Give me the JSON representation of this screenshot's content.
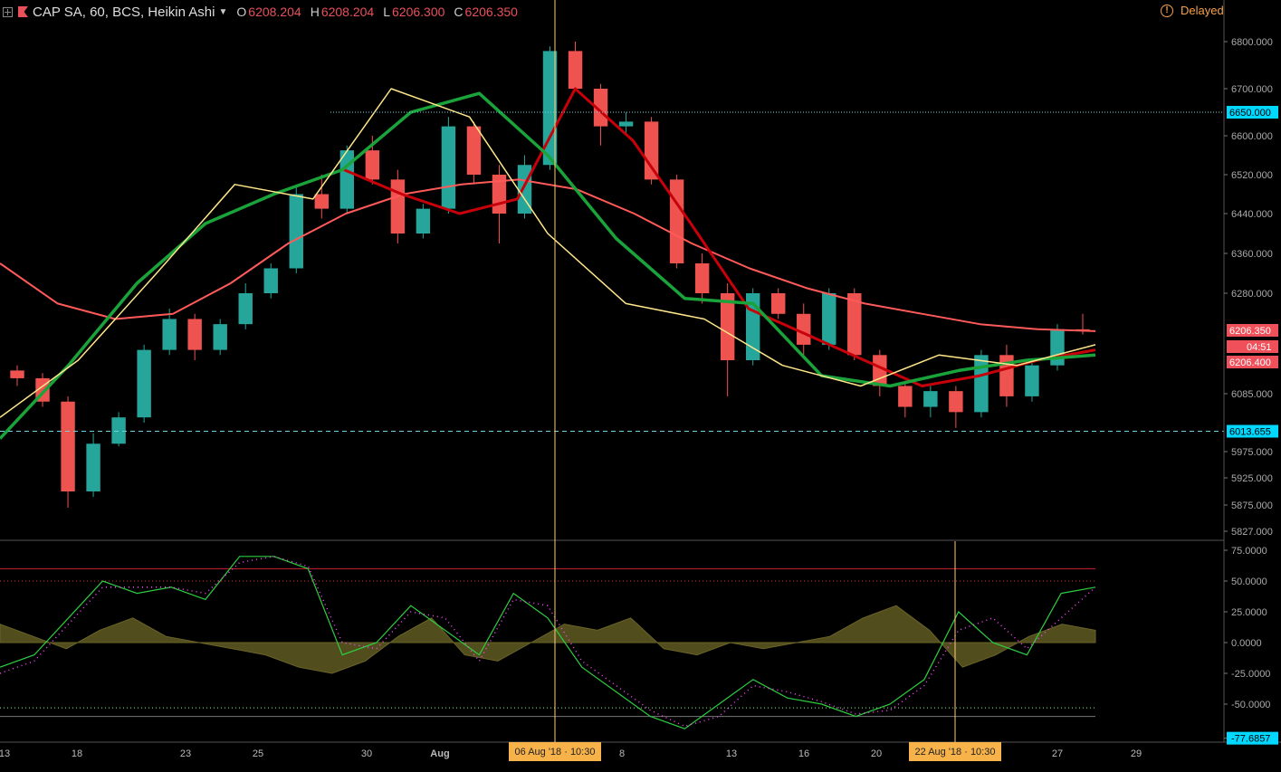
{
  "header": {
    "symbol": "CAP SA, 60, BCS, Heikin Ashi",
    "open_label": "O",
    "open_value": "6208.204",
    "high_label": "H",
    "high_value": "6208.204",
    "low_label": "L",
    "low_value": "6206.300",
    "close_label": "C",
    "close_value": "6206.350",
    "status": "Delayed"
  },
  "colors": {
    "up": "#26a69a",
    "down": "#ef5350",
    "accent_cyan": "#00d8ff",
    "ma_red": "#ff5a5a",
    "ma_dark_red": "#c8000a",
    "ma_green": "#1aa33a",
    "ma_yellow": "#ffe68a"
  },
  "icons": {
    "add": "plus-square-icon",
    "flag": "red-flag-icon",
    "status": "exclamation-circle-icon"
  },
  "chart_data": [
    {
      "type": "candlestick",
      "style": "Heikin Ashi",
      "price_axis_ticks": [
        "6800.000",
        "6700.000",
        "6600.000",
        "6520.000",
        "6440.000",
        "6360.000",
        "6280.000",
        "6085.000",
        "5975.000",
        "5925.000",
        "5875.000",
        "5827.000"
      ],
      "price_axis_tick_values": [
        6800,
        6700,
        6600,
        6520,
        6440,
        6360,
        6280,
        6085,
        5975,
        5925,
        5875,
        5827
      ],
      "time_axis_labels": [
        "13",
        "18",
        "23",
        "25",
        "30",
        "Aug",
        "6",
        "8",
        "13",
        "16",
        "20",
        "23",
        "27",
        "29"
      ],
      "markers": [
        {
          "label": "6650.000",
          "value": 6650,
          "color": "cyan"
        },
        {
          "label": "6206.350",
          "value": 6206.35,
          "color": "red"
        },
        {
          "label": "04:51",
          "color": "red"
        },
        {
          "label": "6206.400",
          "value": 6206.4,
          "color": "red"
        },
        {
          "label": "6013.655",
          "value": 6013.655,
          "color": "cyan"
        }
      ],
      "crosshair_labels": [
        "06 Aug '18 · 10:30",
        "22 Aug '18 · 10:30"
      ],
      "candles_ohlc_approx": [
        [
          6130,
          6140,
          6100,
          6115
        ],
        [
          6115,
          6125,
          6060,
          6070
        ],
        [
          6070,
          6080,
          5870,
          5900
        ],
        [
          5900,
          6010,
          5890,
          5990
        ],
        [
          5990,
          6050,
          5985,
          6040
        ],
        [
          6040,
          6180,
          6030,
          6170
        ],
        [
          6170,
          6250,
          6160,
          6230
        ],
        [
          6230,
          6240,
          6150,
          6170
        ],
        [
          6170,
          6230,
          6160,
          6220
        ],
        [
          6220,
          6300,
          6210,
          6280
        ],
        [
          6280,
          6340,
          6270,
          6330
        ],
        [
          6330,
          6500,
          6320,
          6480
        ],
        [
          6480,
          6520,
          6430,
          6450
        ],
        [
          6450,
          6580,
          6440,
          6570
        ],
        [
          6570,
          6600,
          6500,
          6510
        ],
        [
          6510,
          6530,
          6380,
          6400
        ],
        [
          6400,
          6460,
          6390,
          6450
        ],
        [
          6450,
          6640,
          6440,
          6620
        ],
        [
          6620,
          6630,
          6500,
          6520
        ],
        [
          6520,
          6540,
          6380,
          6440
        ],
        [
          6440,
          6560,
          6430,
          6540
        ],
        [
          6540,
          6790,
          6530,
          6780
        ],
        [
          6780,
          6800,
          6720,
          6700
        ],
        [
          6700,
          6710,
          6580,
          6620
        ],
        [
          6620,
          6650,
          6600,
          6630
        ],
        [
          6630,
          6640,
          6500,
          6510
        ],
        [
          6510,
          6520,
          6330,
          6340
        ],
        [
          6340,
          6360,
          6260,
          6280
        ],
        [
          6280,
          6300,
          6080,
          6150
        ],
        [
          6150,
          6290,
          6140,
          6280
        ],
        [
          6280,
          6290,
          6230,
          6240
        ],
        [
          6240,
          6260,
          6160,
          6180
        ],
        [
          6180,
          6290,
          6170,
          6280
        ],
        [
          6280,
          6290,
          6150,
          6160
        ],
        [
          6160,
          6170,
          6080,
          6100
        ],
        [
          6100,
          6110,
          6040,
          6060
        ],
        [
          6060,
          6100,
          6040,
          6090
        ],
        [
          6090,
          6100,
          6020,
          6050
        ],
        [
          6050,
          6170,
          6040,
          6160
        ],
        [
          6160,
          6180,
          6060,
          6080
        ],
        [
          6080,
          6150,
          6070,
          6140
        ],
        [
          6140,
          6220,
          6130,
          6210
        ],
        [
          6210,
          6240,
          6200,
          6206.35
        ]
      ],
      "moving_averages": [
        {
          "color": "#ff5a5a",
          "values": [
            6340,
            6260,
            6230,
            6240,
            6300,
            6380,
            6440,
            6480,
            6500,
            6510,
            6490,
            6440,
            6380,
            6330,
            6290,
            6260,
            6240,
            6220,
            6210,
            6206.35
          ]
        },
        {
          "color": "#c8000a",
          "values": [
            6530,
            6480,
            6440,
            6470,
            6700,
            6590,
            6420,
            6250,
            6200,
            6150,
            6100,
            6120,
            6150,
            6170
          ]
        },
        {
          "color": "#1aa33a",
          "values": [
            6000,
            6140,
            6300,
            6420,
            6480,
            6530,
            6650,
            6690,
            6560,
            6390,
            6270,
            6260,
            6120,
            6100,
            6130,
            6150,
            6160
          ]
        },
        {
          "color": "#ffe68a",
          "values": [
            6040,
            6150,
            6320,
            6500,
            6470,
            6700,
            6640,
            6400,
            6260,
            6230,
            6140,
            6100,
            6160,
            6140,
            6180
          ]
        }
      ]
    },
    {
      "type": "line",
      "oscillator_axis_ticks": [
        "75.0000",
        "50.0000",
        "25.0000",
        "0.0000",
        "-25.0000",
        "-50.0000",
        "-77.6857"
      ],
      "levels": [
        60,
        50,
        0,
        -53,
        -60
      ],
      "series": [
        {
          "values": [
            -20,
            -10,
            20,
            50,
            40,
            45,
            35,
            70,
            70,
            60,
            -10,
            0,
            30,
            10,
            -10,
            40,
            20,
            -20,
            -40,
            -60,
            -70,
            -50,
            -30,
            -45,
            -50,
            -60,
            -50,
            -30,
            25,
            0,
            -10,
            40,
            45
          ]
        },
        {
          "values": [
            -25,
            -15,
            15,
            45,
            45,
            45,
            40,
            65,
            70,
            62,
            0,
            -5,
            25,
            20,
            -15,
            35,
            30,
            -15,
            -35,
            -55,
            -68,
            -60,
            -35,
            -40,
            -48,
            -58,
            -55,
            -35,
            10,
            20,
            -5,
            20,
            45
          ]
        }
      ],
      "histogram": [
        15,
        5,
        -5,
        10,
        20,
        5,
        0,
        -5,
        -10,
        -20,
        -25,
        -15,
        5,
        20,
        -10,
        -15,
        0,
        15,
        10,
        20,
        -5,
        -10,
        0,
        -5,
        0,
        5,
        20,
        30,
        10,
        -20,
        -10,
        5,
        15,
        10
      ]
    }
  ]
}
